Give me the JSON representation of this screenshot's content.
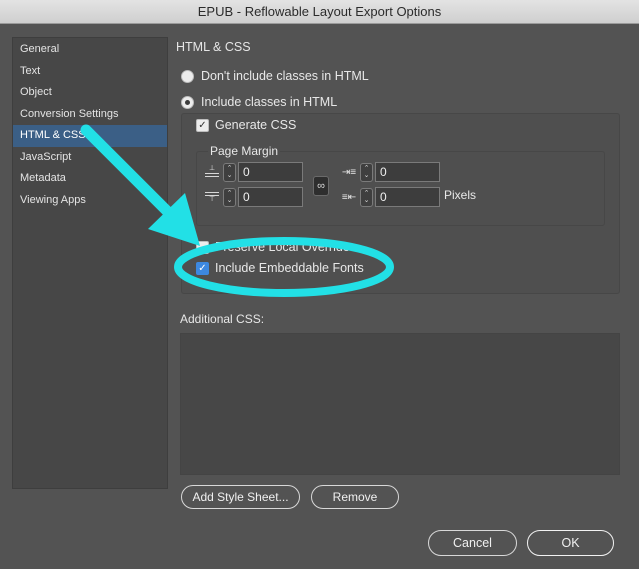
{
  "window": {
    "title": "EPUB - Reflowable Layout Export Options"
  },
  "sidebar": {
    "items": [
      {
        "label": "General"
      },
      {
        "label": "Text"
      },
      {
        "label": "Object"
      },
      {
        "label": "Conversion Settings"
      },
      {
        "label": "HTML & CSS",
        "selected": true
      },
      {
        "label": "JavaScript"
      },
      {
        "label": "Metadata"
      },
      {
        "label": "Viewing Apps"
      }
    ]
  },
  "main": {
    "section_title": "HTML & CSS",
    "radio_no_classes": "Don't include classes in HTML",
    "radio_include_classes": "Include classes in HTML",
    "generate_css": "Generate CSS",
    "page_margin": {
      "label": "Page Margin",
      "top": "0",
      "bottom": "0",
      "left": "0",
      "right": "0",
      "units": "Pixels"
    },
    "preserve_local_overrides": "Preserve Local Overrides",
    "include_embeddable_fonts": "Include Embeddable Fonts",
    "additional_css_label": "Additional CSS:",
    "add_style_sheet_button": "Add Style Sheet...",
    "remove_button": "Remove"
  },
  "footer": {
    "cancel_button": "Cancel",
    "ok_button": "OK"
  },
  "colors": {
    "annotation": "#22e0e6",
    "selection": "#3b5f86",
    "checkbox_checked": "#3d88e0"
  }
}
